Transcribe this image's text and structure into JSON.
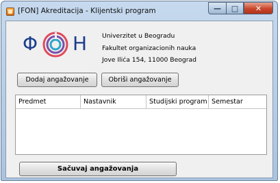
{
  "window": {
    "title": "[FON] Akreditacija - Klijentski program",
    "minimize_symbol": "—",
    "maximize_symbol": "□",
    "close_symbol": "✕",
    "colors": {
      "titlebar": "#b7cde6",
      "close": "#c8452a"
    }
  },
  "logo": {
    "left_letter": "Φ",
    "right_letter": "Η",
    "colors": {
      "primary": "#1a3e8c",
      "ring_outer": "#e04a5b",
      "ring_mid": "#7b4fa8",
      "ring_inner": "#2aa6c9"
    }
  },
  "institution": {
    "line1": "Univerzitet u Beogradu",
    "line2": "Fakultet organizacionih nauka",
    "line3": "Jove Ilića 154, 11000 Beograd"
  },
  "actions": {
    "add_label": "Dodaj angažovanje",
    "delete_label": "Obriši angažovanje",
    "save_label": "Sačuvaj angažovanja"
  },
  "table": {
    "columns": [
      "Predmet",
      "Nastavnik",
      "Studijski program",
      "Semestar"
    ],
    "rows": []
  }
}
